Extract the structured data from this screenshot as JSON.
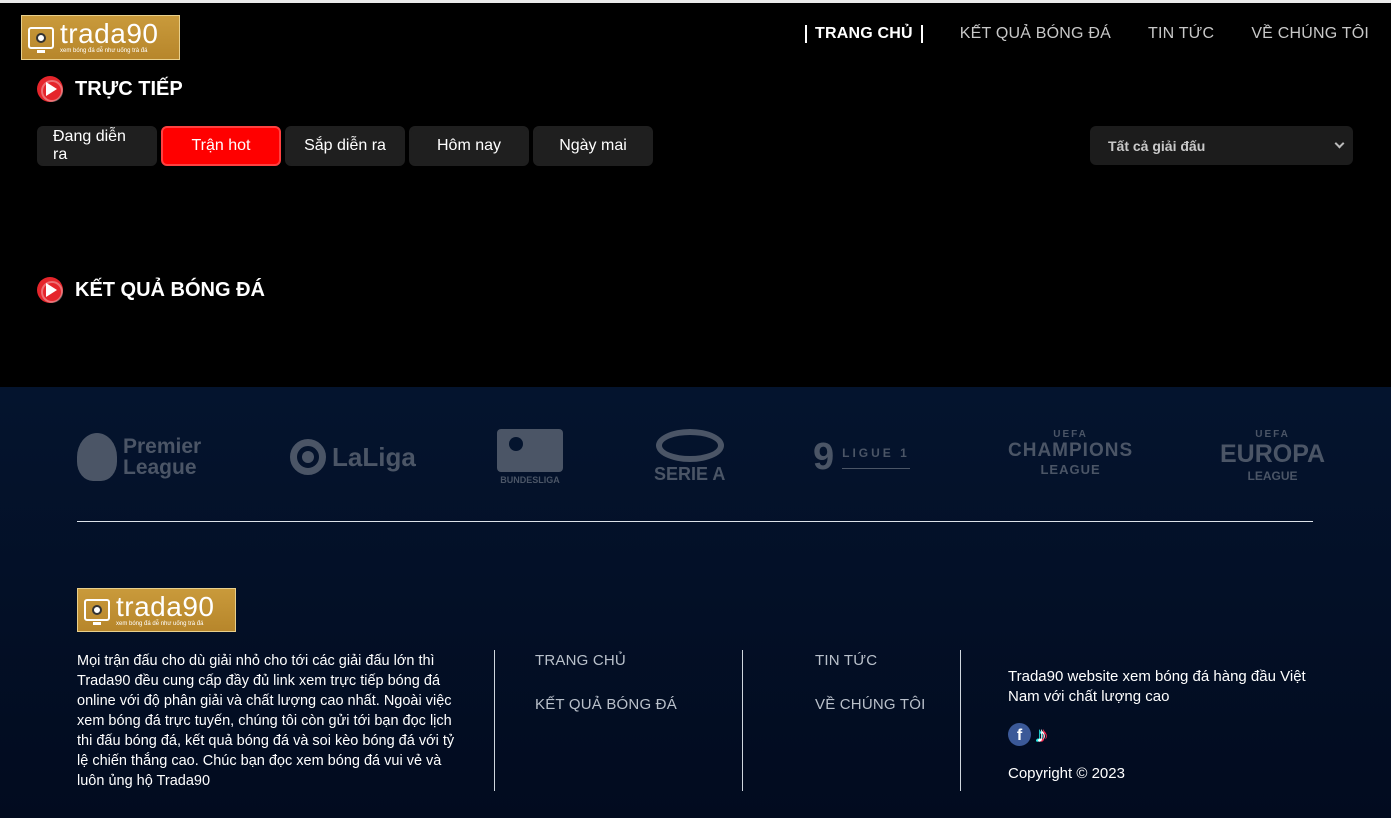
{
  "brand": {
    "name": "trada90",
    "tagline": "xem bóng đá dễ như uống trà đá"
  },
  "nav": {
    "items": [
      {
        "label": "TRANG CHỦ",
        "active": true
      },
      {
        "label": "KẾT QUẢ BÓNG ĐÁ",
        "active": false
      },
      {
        "label": "TIN TỨC",
        "active": false
      },
      {
        "label": "VỀ CHÚNG TÔI",
        "active": false
      }
    ]
  },
  "live": {
    "title": "TRỰC TIẾP",
    "tabs": [
      {
        "label": "Đang diễn ra",
        "active": false
      },
      {
        "label": "Trận hot",
        "active": true
      },
      {
        "label": "Sắp diễn ra",
        "active": false
      },
      {
        "label": "Hôm nay",
        "active": false
      },
      {
        "label": "Ngày mai",
        "active": false
      }
    ],
    "league_select": {
      "value": "Tất cả giải đấu"
    }
  },
  "results": {
    "title": "KẾT QUẢ BÓNG ĐÁ"
  },
  "leagues": {
    "premier": {
      "line1": "Premier",
      "line2": "League"
    },
    "laliga": {
      "name": "LaLiga"
    },
    "bundesliga": {
      "name": "BUNDESLIGA"
    },
    "seriea": {
      "name": "SERIE A"
    },
    "ligue1": {
      "mark": "9",
      "name": "LIGUE 1"
    },
    "ucl": {
      "uefa": "UEFA",
      "line1": "CHAMPIONS",
      "line2": "LEAGUE"
    },
    "uel": {
      "uefa": "UEFA",
      "line1": "EUROPA",
      "line2": "LEAGUE"
    }
  },
  "footer": {
    "about": "Mọi trận đấu cho dù giải nhỏ cho tới các giải đấu lớn thì Trada90 đều cung cấp đầy đủ link xem trực tiếp bóng đá online với độ phân giải và chất lượng cao nhất. Ngoài việc xem bóng đá trực tuyến, chúng tôi còn gửi tới bạn đọc lịch thi đấu bóng đá, kết quả bóng đá và soi kèo bóng đá với tỷ lệ chiến thắng cao. Chúc bạn đọc xem bóng đá vui vẻ và luôn ủng hộ Trada90",
    "links": {
      "home": "TRANG CHỦ",
      "results": "KẾT QUẢ BÓNG ĐÁ",
      "news": "TIN TỨC",
      "about": "VỀ CHÚNG TÔI"
    },
    "info": "Trada90 website xem bóng đá hàng đầu Việt Nam với chất lượng cao",
    "social": {
      "facebook_glyph": "f",
      "tiktok_glyph": "♪"
    },
    "copyright": "Copyright © 2023"
  },
  "colors": {
    "accent": "#ff0000",
    "footer_bg": "#04142e",
    "logo_gold": "#c99a3b"
  }
}
